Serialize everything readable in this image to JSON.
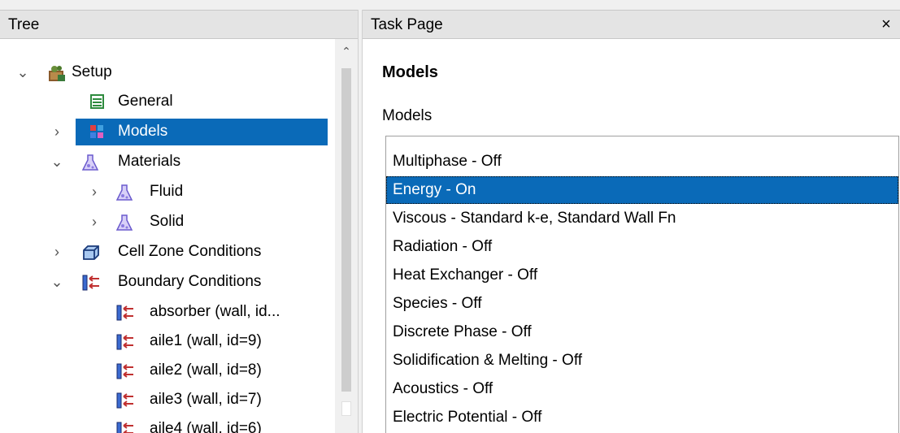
{
  "tree": {
    "header": "Tree",
    "items": [
      {
        "label": "Setup",
        "expander": "⌄",
        "icon": "setup-icon"
      },
      {
        "label": "General",
        "expander": "",
        "icon": "general-icon"
      },
      {
        "label": "Models",
        "expander": "›",
        "icon": "models-icon",
        "selected": true
      },
      {
        "label": "Materials",
        "expander": "⌄",
        "icon": "flask-icon"
      },
      {
        "label": "Fluid",
        "expander": "›",
        "icon": "flask-icon"
      },
      {
        "label": "Solid",
        "expander": "›",
        "icon": "flask-icon"
      },
      {
        "label": "Cell Zone Conditions",
        "expander": "›",
        "icon": "cell-zone-icon"
      },
      {
        "label": "Boundary Conditions",
        "expander": "⌄",
        "icon": "boundary-icon"
      },
      {
        "label": "absorber (wall, id...",
        "expander": "",
        "icon": "boundary-icon"
      },
      {
        "label": "aile1 (wall, id=9)",
        "expander": "",
        "icon": "boundary-icon"
      },
      {
        "label": "aile2 (wall, id=8)",
        "expander": "",
        "icon": "boundary-icon"
      },
      {
        "label": "aile3 (wall, id=7)",
        "expander": "",
        "icon": "boundary-icon"
      },
      {
        "label": "aile4 (wall, id=6)",
        "expander": "",
        "icon": "boundary-icon"
      }
    ]
  },
  "task_page": {
    "header": "Task Page",
    "close": "×",
    "title": "Models",
    "subtitle": "Models",
    "models": [
      {
        "label": "Multiphase - Off"
      },
      {
        "label": "Energy - On",
        "selected": true
      },
      {
        "label": "Viscous - Standard k-e, Standard Wall Fn"
      },
      {
        "label": "Radiation - Off"
      },
      {
        "label": "Heat Exchanger - Off"
      },
      {
        "label": "Species - Off"
      },
      {
        "label": "Discrete Phase - Off"
      },
      {
        "label": "Solidification & Melting - Off"
      },
      {
        "label": "Acoustics - Off"
      },
      {
        "label": "Electric Potential - Off"
      }
    ]
  },
  "colors": {
    "selection": "#0a6ab8"
  }
}
